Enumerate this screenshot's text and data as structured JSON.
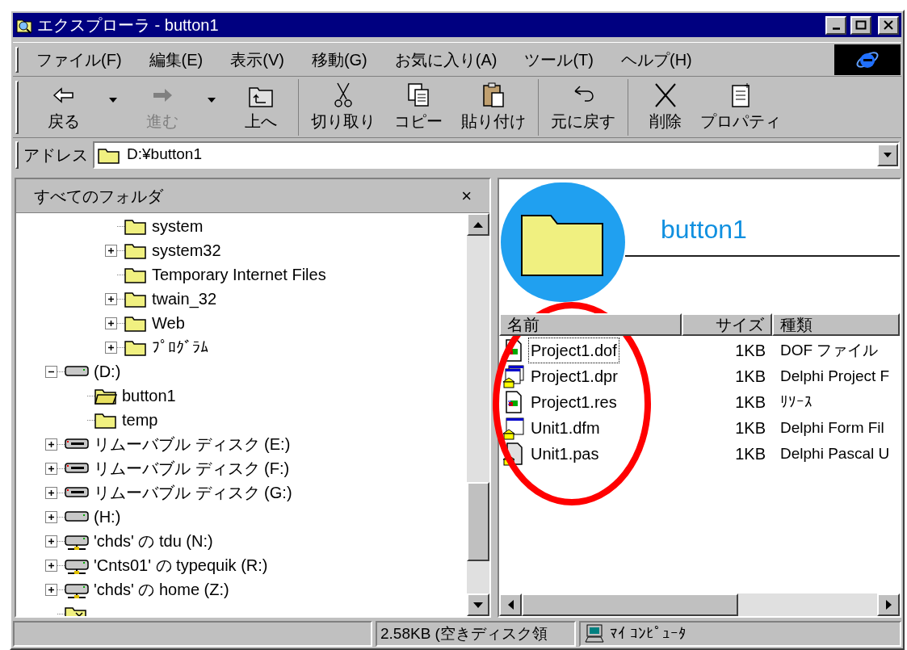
{
  "window": {
    "title": "エクスプローラ - button1"
  },
  "menu": [
    "ファイル(F)",
    "編集(E)",
    "表示(V)",
    "移動(G)",
    "お気に入り(A)",
    "ツール(T)",
    "ヘルプ(H)"
  ],
  "toolbar": [
    [
      {
        "kind": "back",
        "label": "戻る",
        "disabled": false,
        "has_menu": true
      },
      {
        "kind": "forward",
        "label": "進む",
        "disabled": true,
        "has_menu": true
      },
      {
        "kind": "up",
        "label": "上へ",
        "disabled": false,
        "has_menu": false
      }
    ],
    [
      {
        "kind": "cut",
        "label": "切り取り",
        "disabled": false,
        "has_menu": false
      },
      {
        "kind": "copy",
        "label": "コピー",
        "disabled": false,
        "has_menu": false
      },
      {
        "kind": "paste",
        "label": "貼り付け",
        "disabled": false,
        "has_menu": false
      }
    ],
    [
      {
        "kind": "undo",
        "label": "元に戻す",
        "disabled": false,
        "has_menu": false
      }
    ],
    [
      {
        "kind": "delete",
        "label": "削除",
        "disabled": false,
        "has_menu": false
      },
      {
        "kind": "properties",
        "label": "プロパティ",
        "disabled": false,
        "has_menu": false
      }
    ]
  ],
  "address": {
    "label": "アドレス",
    "value": "D:¥button1"
  },
  "folder_pane": {
    "title": "すべてのフォルダ",
    "close": "×",
    "tree": [
      {
        "kind": "hidden",
        "children": [
          {
            "kind": "hidden",
            "children": [
              {
                "kind": "folder",
                "label": "system"
              },
              {
                "kind": "folder",
                "label": "system32",
                "expanded": false
              },
              {
                "kind": "folder",
                "label": "Temporary Internet Files"
              },
              {
                "kind": "folder",
                "label": "twain_32",
                "expanded": false
              },
              {
                "kind": "folder",
                "label": "Web",
                "expanded": false
              },
              {
                "kind": "folder",
                "label": "ﾌﾟﾛｸﾞﾗﾑ",
                "expanded": false
              }
            ]
          }
        ]
      },
      {
        "kind": "drive",
        "label": "(D:)",
        "expanded": true,
        "children": [
          {
            "kind": "open-folder",
            "label": "button1"
          },
          {
            "kind": "folder",
            "label": "temp"
          }
        ]
      },
      {
        "kind": "removable",
        "label": "リムーバブル ディスク (E:)",
        "expanded": false
      },
      {
        "kind": "removable",
        "label": "リムーバブル ディスク (F:)",
        "expanded": false
      },
      {
        "kind": "removable",
        "label": "リムーバブル ディスク (G:)",
        "expanded": false
      },
      {
        "kind": "drive",
        "label": "(H:)",
        "expanded": false
      },
      {
        "kind": "network",
        "label": "'chds' の tdu (N:)",
        "expanded": false
      },
      {
        "kind": "network",
        "label": "'Cnts01' の typequik (R:)",
        "expanded": false
      },
      {
        "kind": "network",
        "label": "'chds' の home (Z:)",
        "expanded": false
      },
      {
        "kind": "special-folder"
      }
    ]
  },
  "content": {
    "folder_title": "button1",
    "columns": [
      "名前",
      "サイズ",
      "種類"
    ],
    "files": [
      {
        "kind": "doc",
        "name": "Project1.dof",
        "size": "1KB",
        "type": "DOF ファイル",
        "focused": true
      },
      {
        "kind": "project",
        "name": "Project1.dpr",
        "size": "1KB",
        "type": "Delphi Project F",
        "focused": false
      },
      {
        "kind": "doc",
        "name": "Project1.res",
        "size": "1KB",
        "type": "ﾘｿｰｽ",
        "focused": false
      },
      {
        "kind": "form",
        "name": "Unit1.dfm",
        "size": "1KB",
        "type": "Delphi Form Fil",
        "focused": false
      },
      {
        "kind": "source",
        "name": "Unit1.pas",
        "size": "1KB",
        "type": "Delphi Pascal U",
        "focused": false
      }
    ]
  },
  "annotation": {
    "kind": "ellipse"
  },
  "status_bar": {
    "panels": [
      {
        "kind": "empty"
      },
      {
        "kind": "text",
        "text": "2.58KB (空きディスク領"
      },
      {
        "kind": "computer",
        "text": "ﾏｲ ｺﾝﾋﾟｭｰﾀ"
      }
    ]
  }
}
